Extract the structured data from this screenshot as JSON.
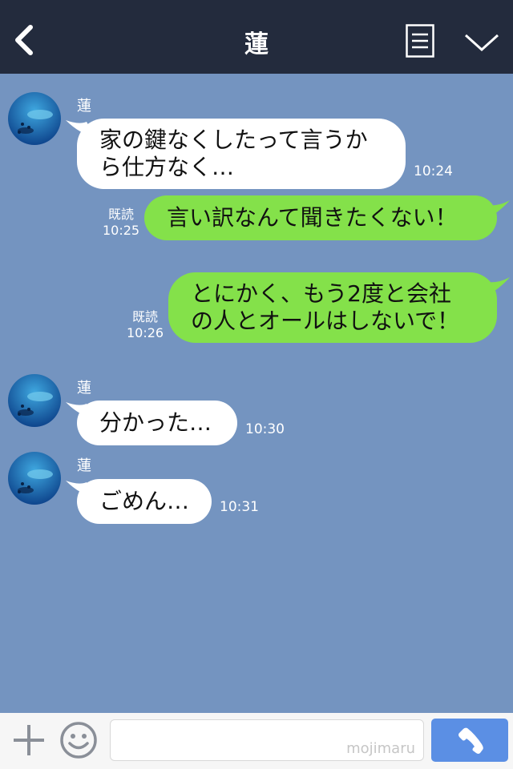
{
  "header": {
    "title": "蓮"
  },
  "messages": [
    {
      "sender": "蓮",
      "lines": [
        "家の鍵なくしたって言うか",
        "ら仕方なく…"
      ],
      "time": "10:24"
    },
    {
      "read": "既読",
      "lines": [
        "言い訳なんて聞きたくない！"
      ],
      "time": "10:25"
    },
    {
      "read": "既読",
      "lines": [
        "とにかく、もう2度と会社",
        "の人とオールはしないで！"
      ],
      "time": "10:26"
    },
    {
      "sender": "蓮",
      "lines": [
        "分かった…"
      ],
      "time": "10:30"
    },
    {
      "sender": "蓮",
      "lines": [
        "ごめん…"
      ],
      "time": "10:31"
    }
  ],
  "input": {
    "watermark": "mojimaru",
    "value": ""
  },
  "colors": {
    "background": "#7494c0",
    "header": "#232b3d",
    "outgoing": "#84e14a",
    "incoming": "#ffffff",
    "call_button": "#5b8fe4"
  },
  "icons": [
    "back-arrow-icon",
    "menu-icon",
    "chevron-down-icon",
    "plus-icon",
    "smile-icon",
    "phone-icon"
  ]
}
